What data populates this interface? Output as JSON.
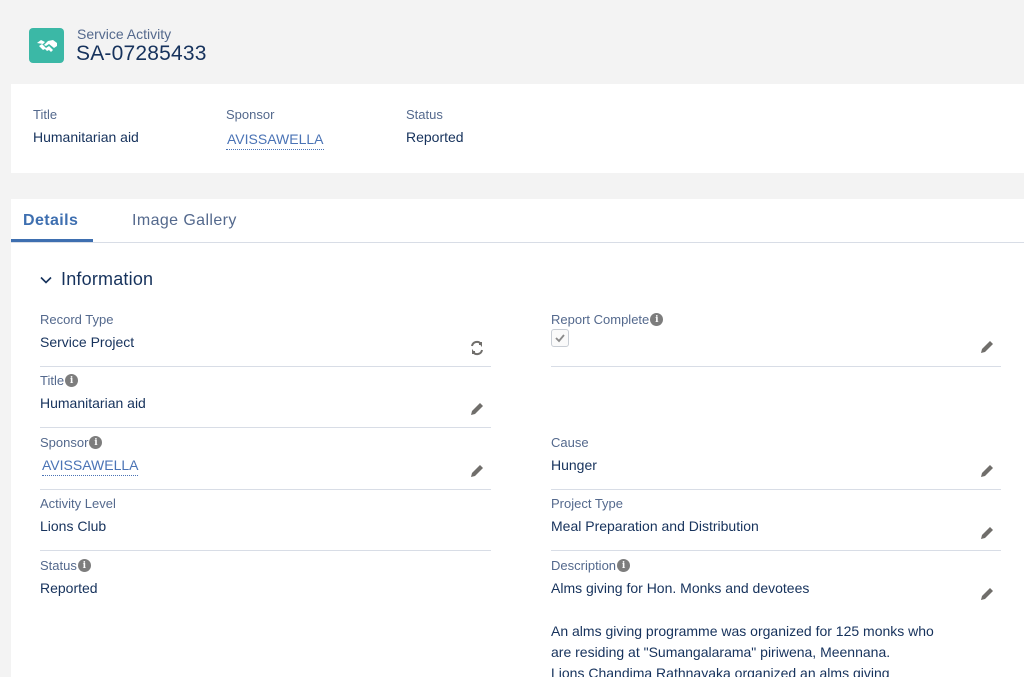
{
  "header": {
    "object_type": "Service Activity",
    "record_name": "SA-07285433",
    "icon": "handshake-icon"
  },
  "highlights": {
    "title": {
      "label": "Title",
      "value": "Humanitarian aid"
    },
    "sponsor": {
      "label": "Sponsor",
      "value": "AVISSAWELLA"
    },
    "status": {
      "label": "Status",
      "value": "Reported"
    }
  },
  "tabs": [
    {
      "label": "Details",
      "active": true
    },
    {
      "label": "Image Gallery",
      "active": false
    }
  ],
  "section": {
    "title": "Information",
    "icon": "chevron-down-icon"
  },
  "fields": {
    "record_type": {
      "label": "Record Type",
      "value": "Service Project",
      "action_icon": "change-record-type-icon"
    },
    "title": {
      "label": "Title",
      "value": "Humanitarian aid"
    },
    "sponsor": {
      "label": "Sponsor",
      "value": "AVISSAWELLA"
    },
    "activity_level": {
      "label": "Activity Level",
      "value": "Lions Club"
    },
    "status": {
      "label": "Status",
      "value": "Reported"
    },
    "report_complete": {
      "label": "Report Complete",
      "checked": true
    },
    "cause": {
      "label": "Cause",
      "value": "Hunger"
    },
    "project_type": {
      "label": "Project Type",
      "value": "Meal Preparation and Distribution"
    },
    "description": {
      "label": "Description",
      "line1": "Alms giving for Hon. Monks and devotees",
      "para_l1": "An alms giving programme was organized for 125 monks who",
      "para_l2": "are residing at \"Sumangalarama\" piriwena, Meennana.",
      "para_l3": "Lions Chandima Rathnayaka organized an alms giving"
    }
  },
  "colors": {
    "accent": "#3e6fb0",
    "link": "#4a73b5",
    "icon_bg": "#3bb8a6",
    "text": "#16325c",
    "label": "#54698d"
  }
}
